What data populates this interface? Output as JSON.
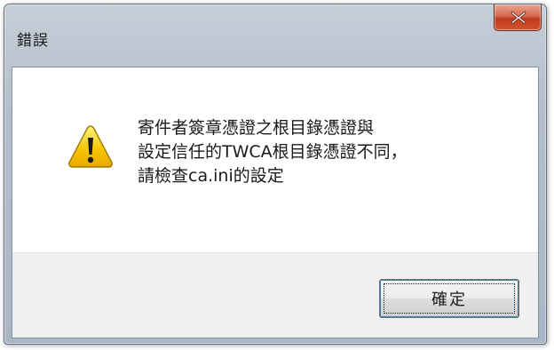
{
  "window": {
    "title": "錯誤"
  },
  "titlebar": {
    "close_icon": "close-x-icon"
  },
  "dialog": {
    "icon": "warning-triangle-icon",
    "message_line_1": "寄件者簽章憑證之根目錄憑證與",
    "message_line_2": "設定信任的TWCA根目錄憑證不同，",
    "message_line_3": "請檢查ca.ini的設定"
  },
  "buttons": {
    "ok_label": "確定"
  },
  "colors": {
    "close_button": "#c23a1c",
    "warning_fill": "#f5c400",
    "button_face": "#e5e5e5",
    "content_background": "#ffffff",
    "footer_background": "#f0f0f0"
  }
}
